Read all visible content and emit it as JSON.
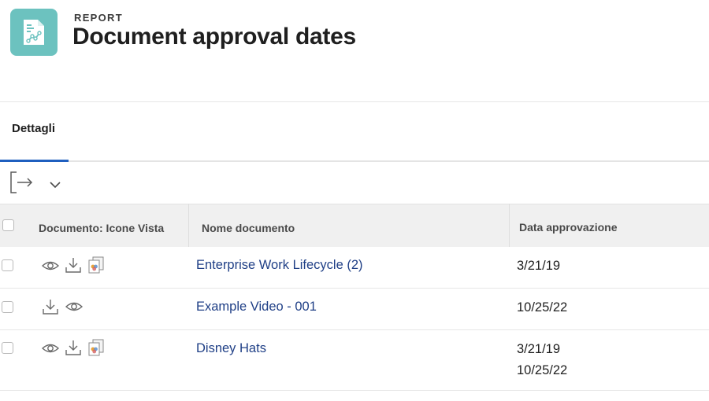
{
  "header": {
    "eyebrow": "REPORT",
    "title": "Document approval dates",
    "icon": "report-chart-icon",
    "icon_color": "#6cc2bf"
  },
  "tabs": [
    {
      "label": "Dettagli",
      "active": true
    }
  ],
  "toolbar": {
    "export_icon": "export-icon",
    "dropdown_icon": "chevron-down-icon"
  },
  "table": {
    "columns": [
      "Documento: Icone Vista",
      "Nome documento",
      "Data approvazione"
    ],
    "rows": [
      {
        "icons": [
          "eye-icon",
          "download-icon",
          "proof-icon"
        ],
        "name": "Enterprise Work Lifecycle (2)",
        "dates": [
          "3/21/19"
        ]
      },
      {
        "icons": [
          "download-icon",
          "eye-icon"
        ],
        "name": "Example Video - 001",
        "dates": [
          "10/25/22"
        ]
      },
      {
        "icons": [
          "eye-icon",
          "download-icon",
          "proof-icon"
        ],
        "name": "Disney Hats",
        "dates": [
          "3/21/19",
          "10/25/22"
        ]
      }
    ]
  },
  "colors": {
    "accent": "#1f5fbf",
    "link": "#1f3f86",
    "header_bg": "#f0f0f0"
  }
}
